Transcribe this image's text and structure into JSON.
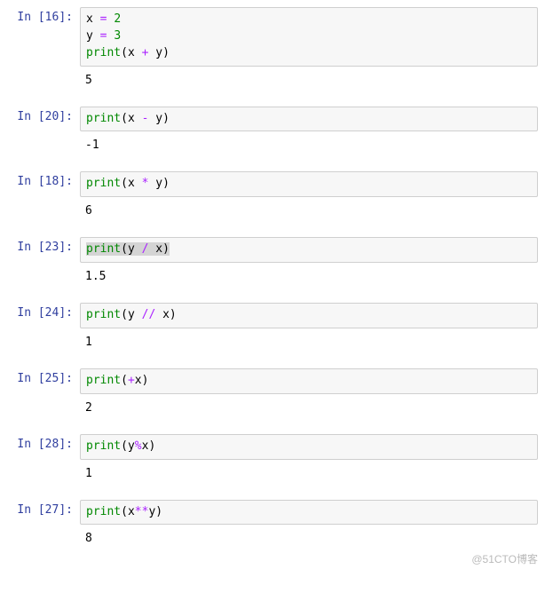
{
  "cells": [
    {
      "prompt": "In  [16]:",
      "lines": [
        [
          {
            "t": "x ",
            "c": "tok-var"
          },
          {
            "t": "=",
            "c": "tok-op"
          },
          {
            "t": " ",
            "c": "tok-var"
          },
          {
            "t": "2",
            "c": "tok-num"
          }
        ],
        [
          {
            "t": "y ",
            "c": "tok-var"
          },
          {
            "t": "=",
            "c": "tok-op"
          },
          {
            "t": " ",
            "c": "tok-var"
          },
          {
            "t": "3",
            "c": "tok-num"
          }
        ],
        [
          {
            "t": "print",
            "c": "tok-func"
          },
          {
            "t": "(x ",
            "c": "tok-paren"
          },
          {
            "t": "+",
            "c": "tok-op"
          },
          {
            "t": " y)",
            "c": "tok-paren"
          }
        ]
      ],
      "output": "5",
      "selected": false
    },
    {
      "prompt": "In  [20]:",
      "lines": [
        [
          {
            "t": "print",
            "c": "tok-func"
          },
          {
            "t": "(x ",
            "c": "tok-paren"
          },
          {
            "t": "-",
            "c": "tok-op"
          },
          {
            "t": " y)",
            "c": "tok-paren"
          }
        ]
      ],
      "output": "-1",
      "selected": false
    },
    {
      "prompt": "In  [18]:",
      "lines": [
        [
          {
            "t": "print",
            "c": "tok-func"
          },
          {
            "t": "(x ",
            "c": "tok-paren"
          },
          {
            "t": "*",
            "c": "tok-op"
          },
          {
            "t": " y)",
            "c": "tok-paren"
          }
        ]
      ],
      "output": "6",
      "selected": false
    },
    {
      "prompt": "In  [23]:",
      "lines": [
        [
          {
            "t": "print",
            "c": "tok-func"
          },
          {
            "t": "(y ",
            "c": "tok-paren"
          },
          {
            "t": "/",
            "c": "tok-op"
          },
          {
            "t": " x)",
            "c": "tok-paren"
          }
        ]
      ],
      "output": "1.5",
      "selected": true
    },
    {
      "prompt": "In  [24]:",
      "lines": [
        [
          {
            "t": "print",
            "c": "tok-func"
          },
          {
            "t": "(y ",
            "c": "tok-paren"
          },
          {
            "t": "//",
            "c": "tok-op"
          },
          {
            "t": " x)",
            "c": "tok-paren"
          }
        ]
      ],
      "output": "1",
      "selected": false
    },
    {
      "prompt": "In  [25]:",
      "lines": [
        [
          {
            "t": "print",
            "c": "tok-func"
          },
          {
            "t": "(",
            "c": "tok-paren"
          },
          {
            "t": "+",
            "c": "tok-op"
          },
          {
            "t": "x)",
            "c": "tok-paren"
          }
        ]
      ],
      "output": "2",
      "selected": false
    },
    {
      "prompt": "In  [28]:",
      "lines": [
        [
          {
            "t": "print",
            "c": "tok-func"
          },
          {
            "t": "(y",
            "c": "tok-paren"
          },
          {
            "t": "%",
            "c": "tok-op"
          },
          {
            "t": "x)",
            "c": "tok-paren"
          }
        ]
      ],
      "output": "1",
      "selected": false
    },
    {
      "prompt": "In  [27]:",
      "lines": [
        [
          {
            "t": "print",
            "c": "tok-func"
          },
          {
            "t": "(x",
            "c": "tok-paren"
          },
          {
            "t": "**",
            "c": "tok-op"
          },
          {
            "t": "y)",
            "c": "tok-paren"
          }
        ]
      ],
      "output": "8",
      "selected": false
    }
  ],
  "watermark": "@51CTO博客"
}
